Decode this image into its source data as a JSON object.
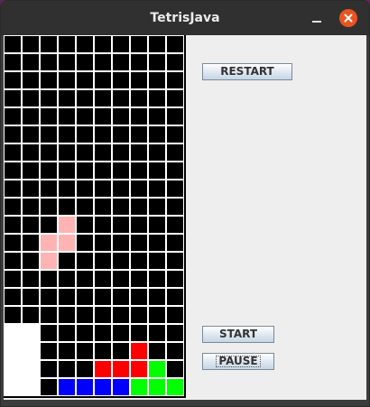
{
  "window": {
    "title": "TetrisJava"
  },
  "buttons": {
    "restart": "RESTART",
    "start": "START",
    "pause": "PAUSE"
  },
  "icons": {
    "minimize": "minimize-icon",
    "close": "close-icon"
  },
  "colors": {
    "empty": "#000000",
    "grid_line": "#ffffff",
    "close_button": "#e95420",
    "window_background": "#eeeeee"
  },
  "board": {
    "columns": 10,
    "rows": 20,
    "falling_piece": {
      "color": "#ffb3b3",
      "cells": [
        [
          3,
          10
        ],
        [
          2,
          11
        ],
        [
          3,
          11
        ],
        [
          2,
          12
        ]
      ]
    },
    "locked_cells": [
      {
        "col": 0,
        "row": 16,
        "color": "#ffffff"
      },
      {
        "col": 1,
        "row": 16,
        "color": "#ffffff"
      },
      {
        "col": 0,
        "row": 17,
        "color": "#ffffff"
      },
      {
        "col": 1,
        "row": 17,
        "color": "#ffffff"
      },
      {
        "col": 0,
        "row": 18,
        "color": "#ffffff"
      },
      {
        "col": 1,
        "row": 18,
        "color": "#ffffff"
      },
      {
        "col": 0,
        "row": 19,
        "color": "#ffffff"
      },
      {
        "col": 1,
        "row": 19,
        "color": "#ffffff"
      },
      {
        "col": 7,
        "row": 17,
        "color": "#ff0000"
      },
      {
        "col": 5,
        "row": 18,
        "color": "#ff0000"
      },
      {
        "col": 6,
        "row": 18,
        "color": "#ff0000"
      },
      {
        "col": 7,
        "row": 18,
        "color": "#ff0000"
      },
      {
        "col": 8,
        "row": 18,
        "color": "#00ff00"
      },
      {
        "col": 7,
        "row": 19,
        "color": "#00ff00"
      },
      {
        "col": 8,
        "row": 19,
        "color": "#00ff00"
      },
      {
        "col": 9,
        "row": 19,
        "color": "#00ff00"
      },
      {
        "col": 3,
        "row": 19,
        "color": "#0000ff"
      },
      {
        "col": 4,
        "row": 19,
        "color": "#0000ff"
      },
      {
        "col": 5,
        "row": 19,
        "color": "#0000ff"
      },
      {
        "col": 6,
        "row": 19,
        "color": "#0000ff"
      }
    ]
  }
}
